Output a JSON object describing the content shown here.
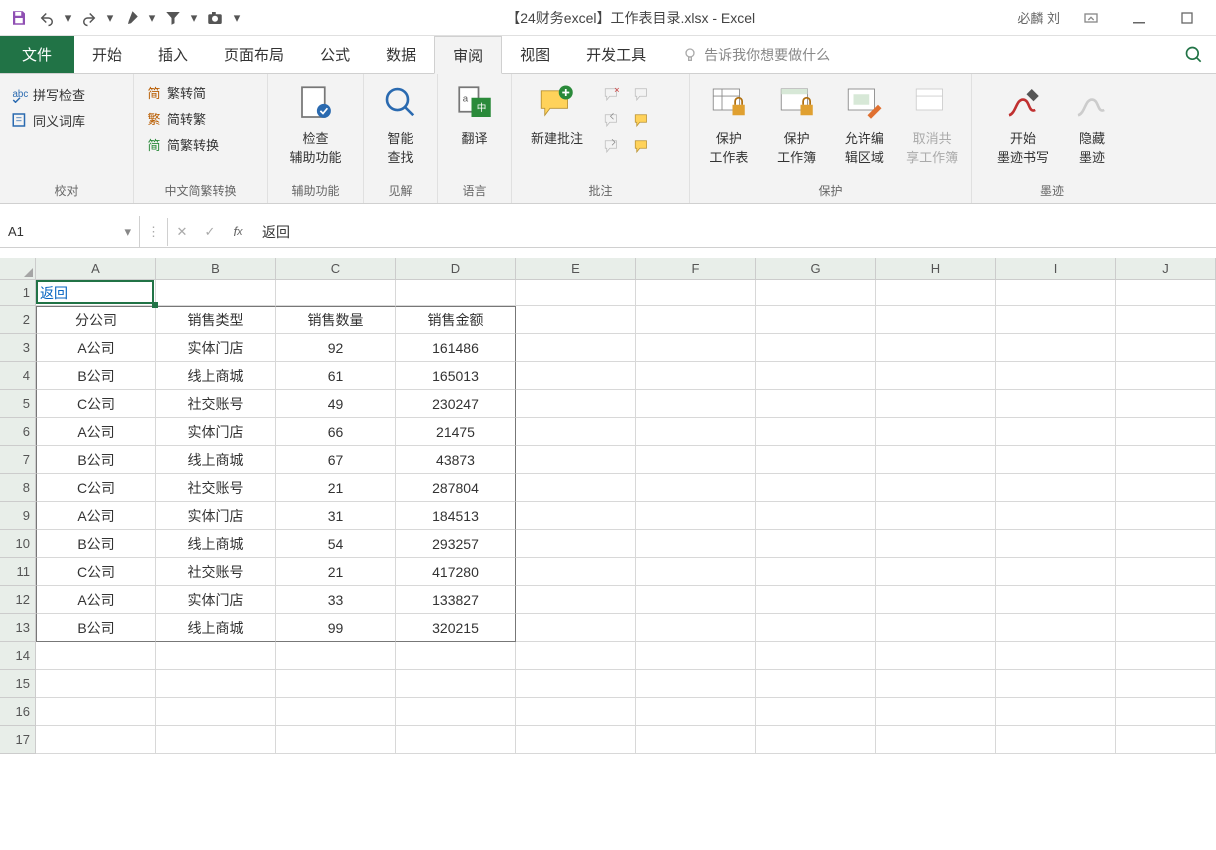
{
  "chart_data": {
    "type": "table",
    "headers": [
      "分公司",
      "销售类型",
      "销售数量",
      "销售金额"
    ],
    "rows": [
      [
        "A公司",
        "实体门店",
        92,
        161486
      ],
      [
        "B公司",
        "线上商城",
        61,
        165013
      ],
      [
        "C公司",
        "社交账号",
        49,
        230247
      ],
      [
        "A公司",
        "实体门店",
        66,
        21475
      ],
      [
        "B公司",
        "线上商城",
        67,
        43873
      ],
      [
        "C公司",
        "社交账号",
        21,
        287804
      ],
      [
        "A公司",
        "实体门店",
        31,
        184513
      ],
      [
        "B公司",
        "线上商城",
        54,
        293257
      ],
      [
        "C公司",
        "社交账号",
        21,
        417280
      ],
      [
        "A公司",
        "实体门店",
        33,
        133827
      ],
      [
        "B公司",
        "线上商城",
        99,
        320215
      ]
    ]
  },
  "title": {
    "text": "【24财务excel】工作表目录.xlsx  -  Excel",
    "user": "必麟 刘"
  },
  "tabs": {
    "file": "文件",
    "home": "开始",
    "insert": "插入",
    "layout": "页面布局",
    "formulas": "公式",
    "data": "数据",
    "review": "审阅",
    "view": "视图",
    "dev": "开发工具",
    "tellme": "告诉我你想要做什么"
  },
  "ribbon": {
    "g1": {
      "label": "校对",
      "spell": "拼写检查",
      "thesaurus": "同义词库"
    },
    "g2": {
      "label": "中文简繁转换",
      "s2t": "繁转简",
      "t2s": "简转繁",
      "conv": "简繁转换",
      "p1": "简",
      "p2": "繁",
      "p3": "简"
    },
    "g3": {
      "label": "辅助功能",
      "l1": "检查",
      "l2": "辅助功能"
    },
    "g4": {
      "label": "见解",
      "l1": "智能",
      "l2": "查找"
    },
    "g5": {
      "label": "语言",
      "l1": "翻译"
    },
    "g6": {
      "label": "批注",
      "l1": "新建批注"
    },
    "g7": {
      "label": "保护",
      "p1a": "保护",
      "p1b": "工作表",
      "p2a": "保护",
      "p2b": "工作簿",
      "p3a": "允许编",
      "p3b": "辑区域",
      "p4a": "取消共",
      "p4b": "享工作簿"
    },
    "g8": {
      "label": "墨迹",
      "p1a": "开始",
      "p1b": "墨迹书写",
      "p2a": "隐藏",
      "p2b": "墨迹"
    }
  },
  "fbar": {
    "name": "A1",
    "value": "返回"
  },
  "cols": [
    "A",
    "B",
    "C",
    "D",
    "E",
    "F",
    "G",
    "H",
    "I",
    "J"
  ],
  "a1": "返回",
  "headers": {
    "c0": "分公司",
    "c1": "销售类型",
    "c2": "销售数量",
    "c3": "销售金额"
  },
  "rows": [
    {
      "c0": "A公司",
      "c1": "实体门店",
      "c2": "92",
      "c3": "161486"
    },
    {
      "c0": "B公司",
      "c1": "线上商城",
      "c2": "61",
      "c3": "165013"
    },
    {
      "c0": "C公司",
      "c1": "社交账号",
      "c2": "49",
      "c3": "230247"
    },
    {
      "c0": "A公司",
      "c1": "实体门店",
      "c2": "66",
      "c3": "21475"
    },
    {
      "c0": "B公司",
      "c1": "线上商城",
      "c2": "67",
      "c3": "43873"
    },
    {
      "c0": "C公司",
      "c1": "社交账号",
      "c2": "21",
      "c3": "287804"
    },
    {
      "c0": "A公司",
      "c1": "实体门店",
      "c2": "31",
      "c3": "184513"
    },
    {
      "c0": "B公司",
      "c1": "线上商城",
      "c2": "54",
      "c3": "293257"
    },
    {
      "c0": "C公司",
      "c1": "社交账号",
      "c2": "21",
      "c3": "417280"
    },
    {
      "c0": "A公司",
      "c1": "实体门店",
      "c2": "33",
      "c3": "133827"
    },
    {
      "c0": "B公司",
      "c1": "线上商城",
      "c2": "99",
      "c3": "320215"
    }
  ]
}
